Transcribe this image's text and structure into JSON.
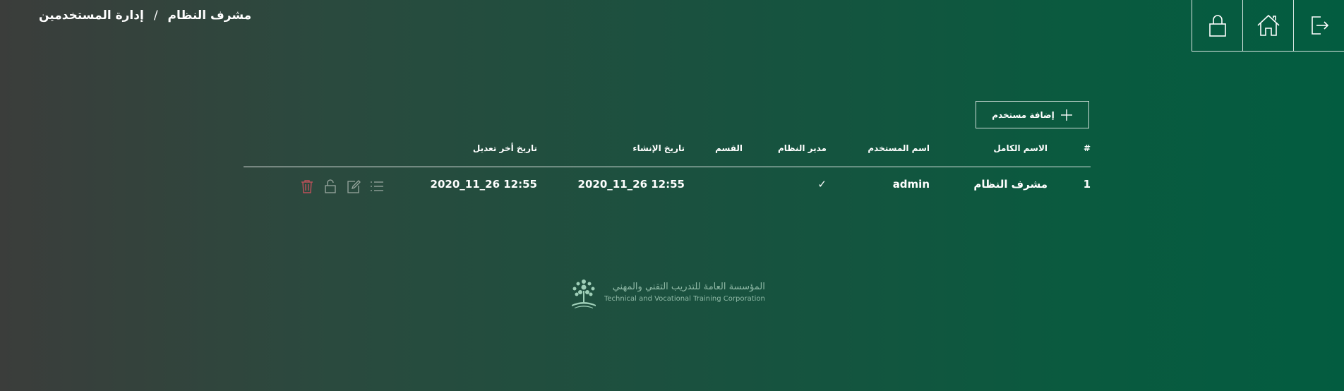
{
  "breadcrumb": {
    "items": [
      "مشرف النظام",
      "إدارة المستخدمين"
    ],
    "separator": "/"
  },
  "topbar": {
    "buttons": [
      {
        "name": "logout",
        "icon": "logout-icon"
      },
      {
        "name": "home",
        "icon": "home-icon"
      },
      {
        "name": "lock",
        "icon": "lock-icon"
      }
    ]
  },
  "toolbar": {
    "add_user_label": "إضافة مستخدم"
  },
  "table": {
    "headers": {
      "index": "#",
      "full_name": "الاسم الكامل",
      "username": "اسم المستخدم",
      "system_admin": "مدير النظام",
      "department": "القسم",
      "created_at": "تاريخ الإنشاء",
      "modified_at": "تاريخ أخر تعديل"
    },
    "rows": [
      {
        "index": "1",
        "full_name": "مشرف النظام",
        "username": "admin",
        "system_admin": "✓",
        "department": "",
        "created_at": "2020_11_26 12:55",
        "modified_at": "2020_11_26 12:55"
      }
    ]
  },
  "footer": {
    "org_name_ar": "المؤسسة العامة للتدريب التقني والمهني",
    "org_name_en": "Technical and Vocational Training Corporation"
  },
  "colors": {
    "delete_icon": "#c0505a",
    "action_icon": "#9aa8a0",
    "logo_text": "#8fb9a6"
  }
}
